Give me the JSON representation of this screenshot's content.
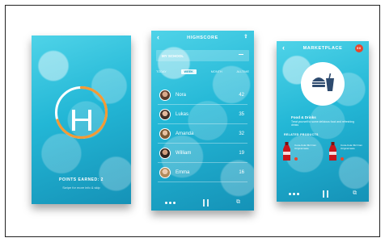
{
  "colors": {
    "accent_orange": "#f39a35",
    "cyan": "#23b7d6",
    "badge_red": "#e8462b"
  },
  "screen1": {
    "points_title": "POINTS EARNED: 2",
    "subtitle": "Swipe for more info & skip",
    "ring_progress": 0.7
  },
  "screen2": {
    "title": "HIGHSCORE",
    "back_icon": "chevron-left-icon",
    "top_icon": "share-icon",
    "school_label": "MY SCHOOL",
    "tabs": [
      "TODAY",
      "WEEK",
      "MONTH",
      "ALLTIME"
    ],
    "selected_tab": "WEEK",
    "rows": [
      {
        "name": "Nora",
        "score": "42"
      },
      {
        "name": "Lukas",
        "score": "35"
      },
      {
        "name": "Amanda",
        "score": "32"
      },
      {
        "name": "William",
        "score": "19"
      },
      {
        "name": "Emma",
        "score": "16"
      }
    ]
  },
  "screen3": {
    "title": "MARKETPLACE",
    "badge": "50",
    "food_title": "Food & Drinks",
    "food_desc": "Treat yourself to some delicious food and refreshing drinks",
    "related_label": "RELATED PRODUCTS",
    "products": [
      {
        "text": "Coca-Cola 33cl Can Original taste"
      },
      {
        "text": "Coca-Cola 33cl Can Original taste"
      }
    ]
  }
}
